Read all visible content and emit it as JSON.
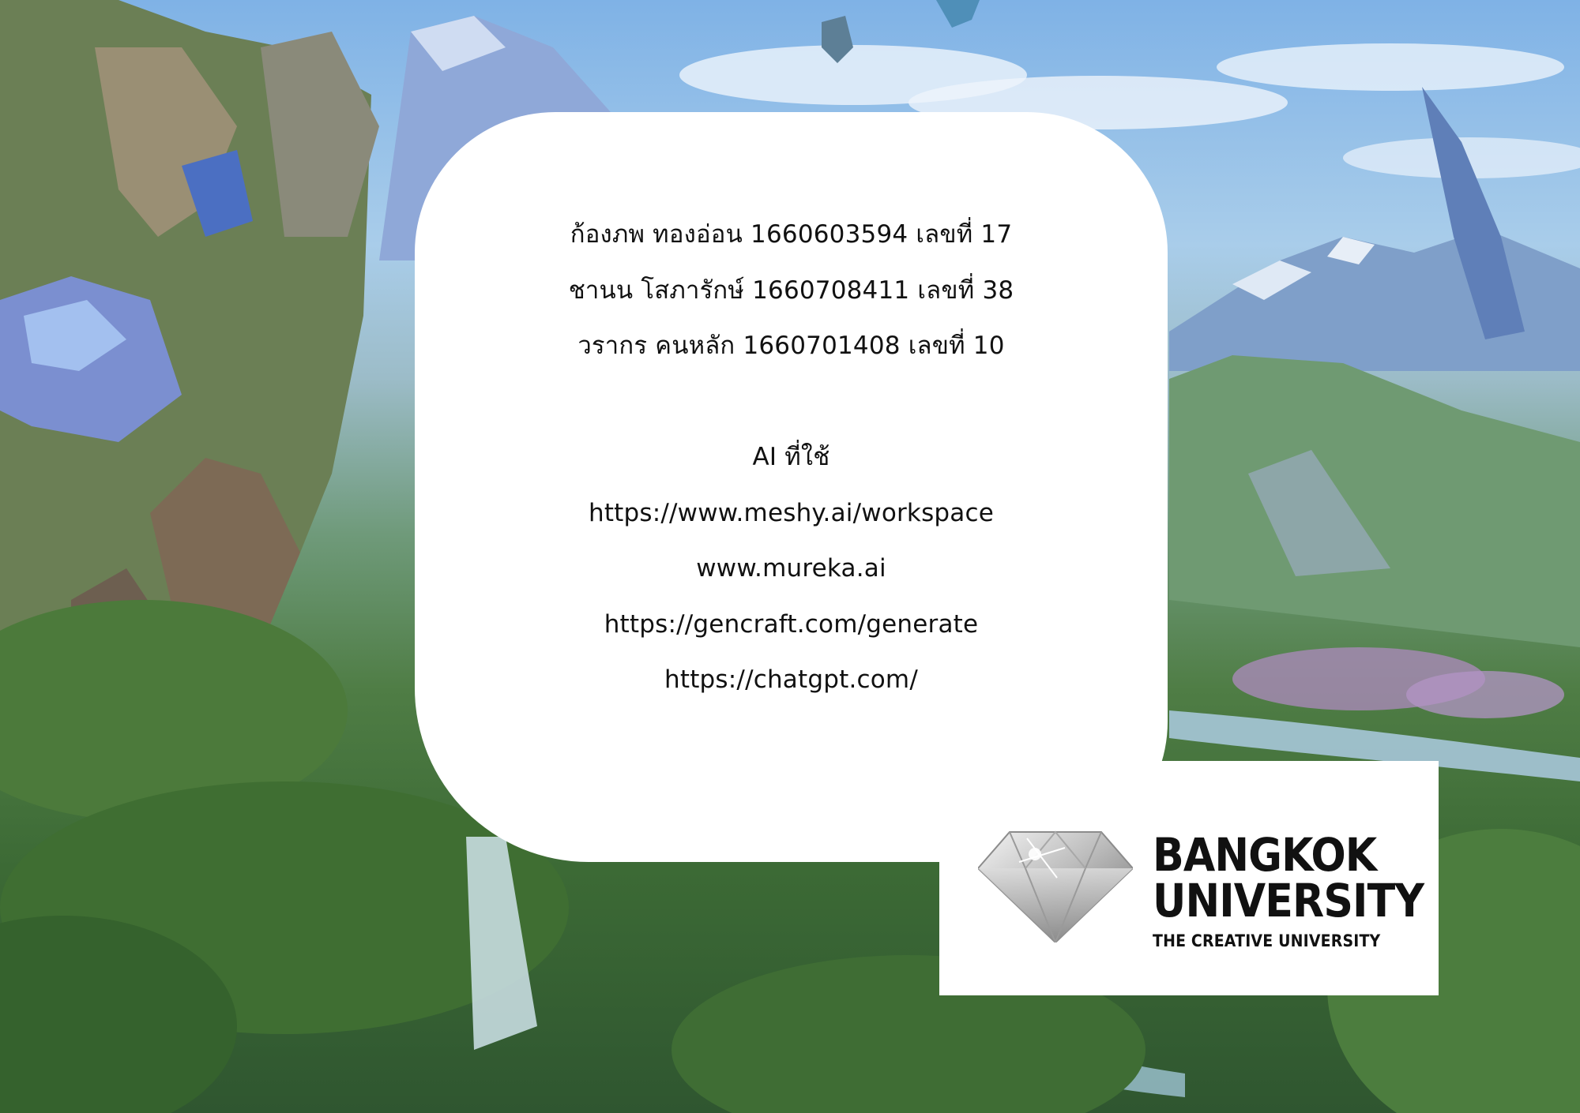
{
  "members": [
    "ก้องภพ ทองอ่อน  1660603594 เลขที่ 17",
    "ชานน โสภารักษ์ 1660708411 เลขที่ 38",
    "วรากร คนหลัก 1660701408 เลขที่ 10"
  ],
  "ai_heading": "AI ที่ใช้",
  "ai_links": [
    "https://www.meshy.ai/workspace",
    "www.mureka.ai",
    "https://gencraft.com/generate",
    "https://chatgpt.com/"
  ],
  "logo": {
    "line1": "BANGKOK",
    "line2": "UNIVERSITY",
    "tagline": "THE CREATIVE UNIVERSITY"
  }
}
